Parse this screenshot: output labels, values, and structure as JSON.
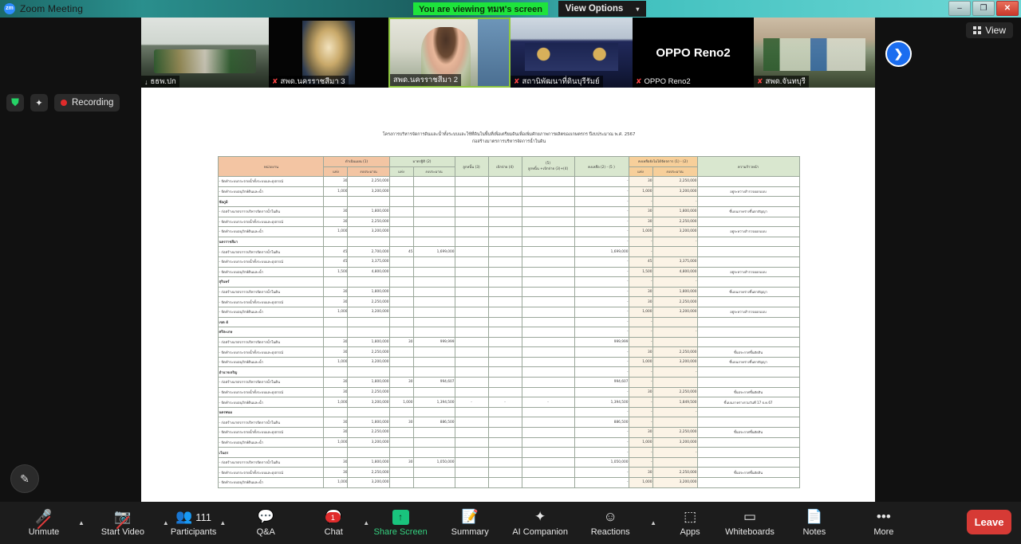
{
  "window": {
    "app_title": "Zoom Meeting",
    "logo_text": "zm",
    "sharing_banner": "You are viewing ทมห's screen",
    "view_options_label": "View Options",
    "view_options_caret": "▾",
    "minimize": "–",
    "maximize": "❐",
    "close": "✕"
  },
  "overlay": {
    "encryption_icon": "⛊",
    "ai_sparkle_icon": "✦",
    "recording_label": "Recording",
    "view_label": "View",
    "next_page_arrow": "❯",
    "annotate_icon": "✎"
  },
  "filmstrip": {
    "participants": [
      {
        "name": "ธธพ.ปก",
        "muted": false,
        "speaking": false,
        "mic_icon": "↓"
      },
      {
        "name": "สพด.นครราชสีมา 3",
        "muted": true,
        "speaking": false,
        "mic_icon": "✘"
      },
      {
        "name": "สพด.นครราชสีมา 2",
        "muted": false,
        "speaking": true,
        "mic_icon": ""
      },
      {
        "name": "สถานิพัฒนาที่ดินบุรีรัมย์",
        "muted": true,
        "speaking": false,
        "mic_icon": "✘"
      },
      {
        "name": "OPPO Reno2",
        "muted": true,
        "speaking": false,
        "mic_icon": "✘",
        "display_name_big": "OPPO Reno2"
      },
      {
        "name": "สพด.จันทบุรี",
        "muted": true,
        "speaking": false,
        "mic_icon": "✘"
      }
    ]
  },
  "shared_screen": {
    "doc_title_line1": "โครงการบริหารจัดการดินและน้ำทั้งระบบและใช้ที่ดินในพื้นที่เพื่อเตรียมดินเพื่อเพิ่มศักยภาพการผลิตของเกษตรกร ปีงบประมาณ พ.ศ. 2567",
    "doc_title_line2": "ก่อสร้างมาตรการบริหารจัดการน้ำในดิน",
    "table": {
      "headers": {
        "org": "หน่วยงาน",
        "g1": "ดำเนินแผน (1)",
        "g2": "มาตรฐิติ (2)",
        "c_units": "แห่ง",
        "c_budget": "งบประมาณ",
        "g3": "ลูกหนิ้น (3)",
        "g4": "เบิกจ่าย (4)",
        "g5_top": "(5)",
        "g5_bottom": "ลูกหนิ้น +เบิกจ่าย (3)+(4)",
        "g6": "คงเหลือ (2) - (5 )",
        "g7": "คงเหลือยังไม่ได้จัดจการ (1) - (2)",
        "g8": "ความก้าวหน้า"
      },
      "rows": [
        {
          "type": "item",
          "org": "- จัดทำระบบกระจายน้ำทั้งระบบและอุปกรณ์",
          "p_units": "30",
          "p_budget": "2,250,000",
          "a_units": "",
          "a_budget": "",
          "debtor": "",
          "disbursed": "",
          "sum": "",
          "remain": "-",
          "r_units": "30",
          "r_budget": "2,250,000",
          "note": ""
        },
        {
          "type": "item",
          "org": "- จัดทำระบบอนุรักษ์ดินและน้ำ",
          "p_units": "1,000",
          "p_budget": "3,200,000",
          "a_units": "",
          "a_budget": "",
          "debtor": "",
          "disbursed": "",
          "sum": "",
          "remain": "-",
          "r_units": "1,000",
          "r_budget": "3,200,000",
          "note": "อยู่ระหว่างสำรวจออกแบบ"
        },
        {
          "type": "group",
          "org": "ชัยภูมิ",
          "p_units": "",
          "p_budget": "",
          "a_units": "",
          "a_budget": "",
          "debtor": "",
          "disbursed": "",
          "sum": "",
          "remain": "-",
          "r_units": "-",
          "r_budget": "-",
          "note": ""
        },
        {
          "type": "item",
          "org": "- ก่อสร้างมาตรการบริหารจัดการน้ำในดิน",
          "p_units": "30",
          "p_budget": "1,800,000",
          "a_units": "",
          "a_budget": "",
          "debtor": "",
          "disbursed": "",
          "sum": "",
          "remain": "-",
          "r_units": "30",
          "r_budget": "1,800,000",
          "note": "ขึ้นบนภาคร่างขึ้นตาสัญญา"
        },
        {
          "type": "item",
          "org": "- จัดทำระบบกระจายน้ำทั้งระบบและอุปกรณ์",
          "p_units": "30",
          "p_budget": "2,250,000",
          "a_units": "",
          "a_budget": "",
          "debtor": "",
          "disbursed": "",
          "sum": "",
          "remain": "-",
          "r_units": "30",
          "r_budget": "2,250,000",
          "note": ""
        },
        {
          "type": "item",
          "org": "- จัดทำระบบอนุรักษ์ดินและน้ำ",
          "p_units": "1,000",
          "p_budget": "3,200,000",
          "a_units": "",
          "a_budget": "",
          "debtor": "",
          "disbursed": "",
          "sum": "",
          "remain": "-",
          "r_units": "1,000",
          "r_budget": "3,200,000",
          "note": "อยู่ระหว่างสำรวจออกแบบ"
        },
        {
          "type": "group",
          "org": "นครราชสีมา",
          "p_units": "",
          "p_budget": "",
          "a_units": "",
          "a_budget": "",
          "debtor": "",
          "disbursed": "",
          "sum": "",
          "remain": "-",
          "r_units": "-",
          "r_budget": "-",
          "note": ""
        },
        {
          "type": "item",
          "org": "- ก่อสร้างมาตรการบริหารจัดการน้ำในดิน",
          "p_units": "45",
          "p_budget": "2,700,000",
          "a_units": "45",
          "a_budget": "1,699,000",
          "debtor": "",
          "disbursed": "",
          "sum": "",
          "remain": "1,699,000",
          "r_units": "-",
          "r_budget": "",
          "note": ""
        },
        {
          "type": "item",
          "org": "- จัดทำระบบกระจายน้ำทั้งระบบและอุปกรณ์",
          "p_units": "45",
          "p_budget": "3,375,000",
          "a_units": "",
          "a_budget": "",
          "debtor": "",
          "disbursed": "",
          "sum": "",
          "remain": "-",
          "r_units": "45",
          "r_budget": "3,375,000",
          "note": ""
        },
        {
          "type": "item",
          "org": "- จัดทำระบบอนุรักษ์ดินและน้ำ",
          "p_units": "1,500",
          "p_budget": "4,800,000",
          "a_units": "",
          "a_budget": "",
          "debtor": "",
          "disbursed": "",
          "sum": "",
          "remain": "-",
          "r_units": "1,500",
          "r_budget": "4,800,000",
          "note": "อยู่ระหว่างสำรวจออกแบบ"
        },
        {
          "type": "group",
          "org": "สุรินทร์",
          "p_units": "",
          "p_budget": "",
          "a_units": "",
          "a_budget": "",
          "debtor": "",
          "disbursed": "",
          "sum": "",
          "remain": "-",
          "r_units": "-",
          "r_budget": "-",
          "note": ""
        },
        {
          "type": "item",
          "org": "- ก่อสร้างมาตรการบริหารจัดการน้ำในดิน",
          "p_units": "30",
          "p_budget": "1,800,000",
          "a_units": "",
          "a_budget": "",
          "debtor": "",
          "disbursed": "",
          "sum": "",
          "remain": "-",
          "r_units": "30",
          "r_budget": "1,800,000",
          "note": "ขึ้นบนภาคร่างขึ้นตาสัญญา"
        },
        {
          "type": "item",
          "org": "- จัดทำระบบกระจายน้ำทั้งระบบและอุปกรณ์",
          "p_units": "30",
          "p_budget": "2,250,000",
          "a_units": "",
          "a_budget": "",
          "debtor": "",
          "disbursed": "",
          "sum": "",
          "remain": "-",
          "r_units": "30",
          "r_budget": "2,250,000",
          "note": ""
        },
        {
          "type": "item",
          "org": "- จัดทำระบบอนุรักษ์ดินและน้ำ",
          "p_units": "1,000",
          "p_budget": "3,200,000",
          "a_units": "",
          "a_budget": "",
          "debtor": "",
          "disbursed": "",
          "sum": "",
          "remain": "-",
          "r_units": "1,000",
          "r_budget": "3,200,000",
          "note": "อยู่ระหว่างสำรวจออกแบบ"
        },
        {
          "type": "group",
          "org": "เขต 4",
          "p_units": "",
          "p_budget": "",
          "a_units": "",
          "a_budget": "",
          "debtor": "",
          "disbursed": "",
          "sum": "",
          "remain": "-",
          "r_units": "-",
          "r_budget": "",
          "note": ""
        },
        {
          "type": "group",
          "org": "ศรีสะเกษ",
          "p_units": "",
          "p_budget": "",
          "a_units": "",
          "a_budget": "",
          "debtor": "",
          "disbursed": "",
          "sum": "",
          "remain": "-",
          "r_units": "-",
          "r_budget": "-",
          "note": ""
        },
        {
          "type": "item",
          "org": "- ก่อสร้างมาตรการบริหารจัดการน้ำในดิน",
          "p_units": "30",
          "p_budget": "1,800,000",
          "a_units": "30",
          "a_budget": "999,999",
          "debtor": "",
          "disbursed": "",
          "sum": "",
          "remain": "999,999",
          "r_units": "-",
          "r_budget": "",
          "note": ""
        },
        {
          "type": "item",
          "org": "- จัดทำระบบกระจายน้ำทั้งระบบและอุปกรณ์",
          "p_units": "30",
          "p_budget": "2,250,000",
          "a_units": "",
          "a_budget": "",
          "debtor": "",
          "disbursed": "",
          "sum": "",
          "remain": "-",
          "r_units": "30",
          "r_budget": "2,250,000",
          "note": "ขึ้นประกาศขึ้นตัดสิน"
        },
        {
          "type": "item",
          "org": "- จัดทำระบบอนุรักษ์ดินและน้ำ",
          "p_units": "1,000",
          "p_budget": "3,200,000",
          "a_units": "",
          "a_budget": "",
          "debtor": "",
          "disbursed": "",
          "sum": "",
          "remain": "-",
          "r_units": "1,000",
          "r_budget": "3,200,000",
          "note": "ขึ้นบนภาคร่างขึ้นตาสัญญา"
        },
        {
          "type": "group",
          "org": "อำนาจเจริญ",
          "p_units": "",
          "p_budget": "",
          "a_units": "",
          "a_budget": "",
          "debtor": "",
          "disbursed": "",
          "sum": "",
          "remain": "-",
          "r_units": "-",
          "r_budget": "-",
          "note": ""
        },
        {
          "type": "item",
          "org": "- ก่อสร้างมาตรการบริหารจัดการน้ำในดิน",
          "p_units": "30",
          "p_budget": "1,800,000",
          "a_units": "30",
          "a_budget": "994,607",
          "debtor": "",
          "disbursed": "",
          "sum": "",
          "remain": "994,607",
          "r_units": "-",
          "r_budget": "",
          "note": ""
        },
        {
          "type": "item",
          "org": "- จัดทำระบบกระจายน้ำทั้งระบบและอุปกรณ์",
          "p_units": "30",
          "p_budget": "2,250,000",
          "a_units": "",
          "a_budget": "",
          "debtor": "",
          "disbursed": "",
          "sum": "",
          "remain": "-",
          "r_units": "30",
          "r_budget": "2,250,000",
          "note": "ขึ้นประกาศขึ้นตัดสิน"
        },
        {
          "type": "item",
          "org": "- จัดทำระบบอนุรักษ์ดินและน้ำ",
          "p_units": "1,000",
          "p_budget": "3,200,000",
          "a_units": "1,000",
          "a_budget": "1,394,500",
          "debtor": "-",
          "disbursed": "-",
          "sum": "-",
          "remain": "1,394,500",
          "r_units": "-",
          "r_budget": "1,849,500",
          "note": "ขึ้นบนภาคร่างรวมวันที่ 17 ธ.ค.67"
        },
        {
          "type": "group",
          "org": "นครพนม",
          "p_units": "",
          "p_budget": "",
          "a_units": "",
          "a_budget": "",
          "debtor": "",
          "disbursed": "",
          "sum": "",
          "remain": "-",
          "r_units": "-",
          "r_budget": "-",
          "note": ""
        },
        {
          "type": "item",
          "org": "- ก่อสร้างมาตรการบริหารจัดการน้ำในดิน",
          "p_units": "30",
          "p_budget": "1,800,000",
          "a_units": "30",
          "a_budget": "886,500",
          "debtor": "",
          "disbursed": "",
          "sum": "",
          "remain": "886,500",
          "r_units": "-",
          "r_budget": "",
          "note": ""
        },
        {
          "type": "item",
          "org": "- จัดทำระบบกระจายน้ำทั้งระบบและอุปกรณ์",
          "p_units": "30",
          "p_budget": "2,250,000",
          "a_units": "",
          "a_budget": "",
          "debtor": "",
          "disbursed": "",
          "sum": "",
          "remain": "-",
          "r_units": "30",
          "r_budget": "2,250,000",
          "note": "ขึ้นประกาศขึ้นตัดสิน"
        },
        {
          "type": "item",
          "org": "- จัดทำระบบอนุรักษ์ดินและน้ำ",
          "p_units": "1,000",
          "p_budget": "3,200,000",
          "a_units": "",
          "a_budget": "",
          "debtor": "",
          "disbursed": "",
          "sum": "",
          "remain": "-",
          "r_units": "1,000",
          "r_budget": "3,200,000",
          "note": ""
        },
        {
          "type": "group",
          "org": "เว้นธร",
          "p_units": "",
          "p_budget": "",
          "a_units": "",
          "a_budget": "",
          "debtor": "",
          "disbursed": "",
          "sum": "",
          "remain": "-",
          "r_units": "-",
          "r_budget": "-",
          "note": ""
        },
        {
          "type": "item",
          "org": "- ก่อสร้างมาตรการบริหารจัดการน้ำในดิน",
          "p_units": "30",
          "p_budget": "1,800,000",
          "a_units": "30",
          "a_budget": "1,050,000",
          "debtor": "",
          "disbursed": "",
          "sum": "",
          "remain": "1,050,000",
          "r_units": "-",
          "r_budget": "",
          "note": ""
        },
        {
          "type": "item",
          "org": "- จัดทำระบบกระจายน้ำทั้งระบบและอุปกรณ์",
          "p_units": "30",
          "p_budget": "2,250,000",
          "a_units": "",
          "a_budget": "",
          "debtor": "",
          "disbursed": "",
          "sum": "",
          "remain": "-",
          "r_units": "30",
          "r_budget": "2,250,000",
          "note": "ขึ้นประกาศขึ้นตัดสิน"
        },
        {
          "type": "item",
          "org": "- จัดทำระบบอนุรักษ์ดินและน้ำ",
          "p_units": "1,000",
          "p_budget": "3,200,000",
          "a_units": "",
          "a_budget": "",
          "debtor": "",
          "disbursed": "",
          "sum": "",
          "remain": "-",
          "r_units": "1,000",
          "r_budget": "3,200,000",
          "note": ""
        }
      ]
    }
  },
  "toolbar": {
    "items": [
      {
        "label": "Unmute",
        "icon": "🎤",
        "caret": true,
        "muted": true
      },
      {
        "label": "Start Video",
        "icon": "📷",
        "caret": true,
        "muted": true
      },
      {
        "label": "Participants",
        "icon": "👥",
        "caret": true,
        "count": "111"
      },
      {
        "label": "Q&A",
        "icon": "💬",
        "caret": false
      },
      {
        "label": "Chat",
        "icon": "💬",
        "caret": true,
        "badge": "1"
      },
      {
        "label": "Share Screen",
        "icon": "↑",
        "caret": false,
        "green": true
      },
      {
        "label": "Summary",
        "icon": "📝",
        "caret": false
      },
      {
        "label": "AI Companion",
        "icon": "✦",
        "caret": false
      },
      {
        "label": "Reactions",
        "icon": "☺",
        "caret": true
      },
      {
        "label": "Apps",
        "icon": "⬚",
        "caret": false
      },
      {
        "label": "Whiteboards",
        "icon": "▭",
        "caret": false
      },
      {
        "label": "Notes",
        "icon": "📄",
        "caret": false
      },
      {
        "label": "More",
        "icon": "•••",
        "caret": false
      }
    ],
    "leave_label": "Leave"
  },
  "colors": {
    "accent_blue": "#1a6df0",
    "share_green": "#19c37d",
    "leave_red": "#d63a35",
    "banner_green": "#1ee43c",
    "header_orange": "#f3c5a3",
    "header_green": "#d9e7cf"
  }
}
